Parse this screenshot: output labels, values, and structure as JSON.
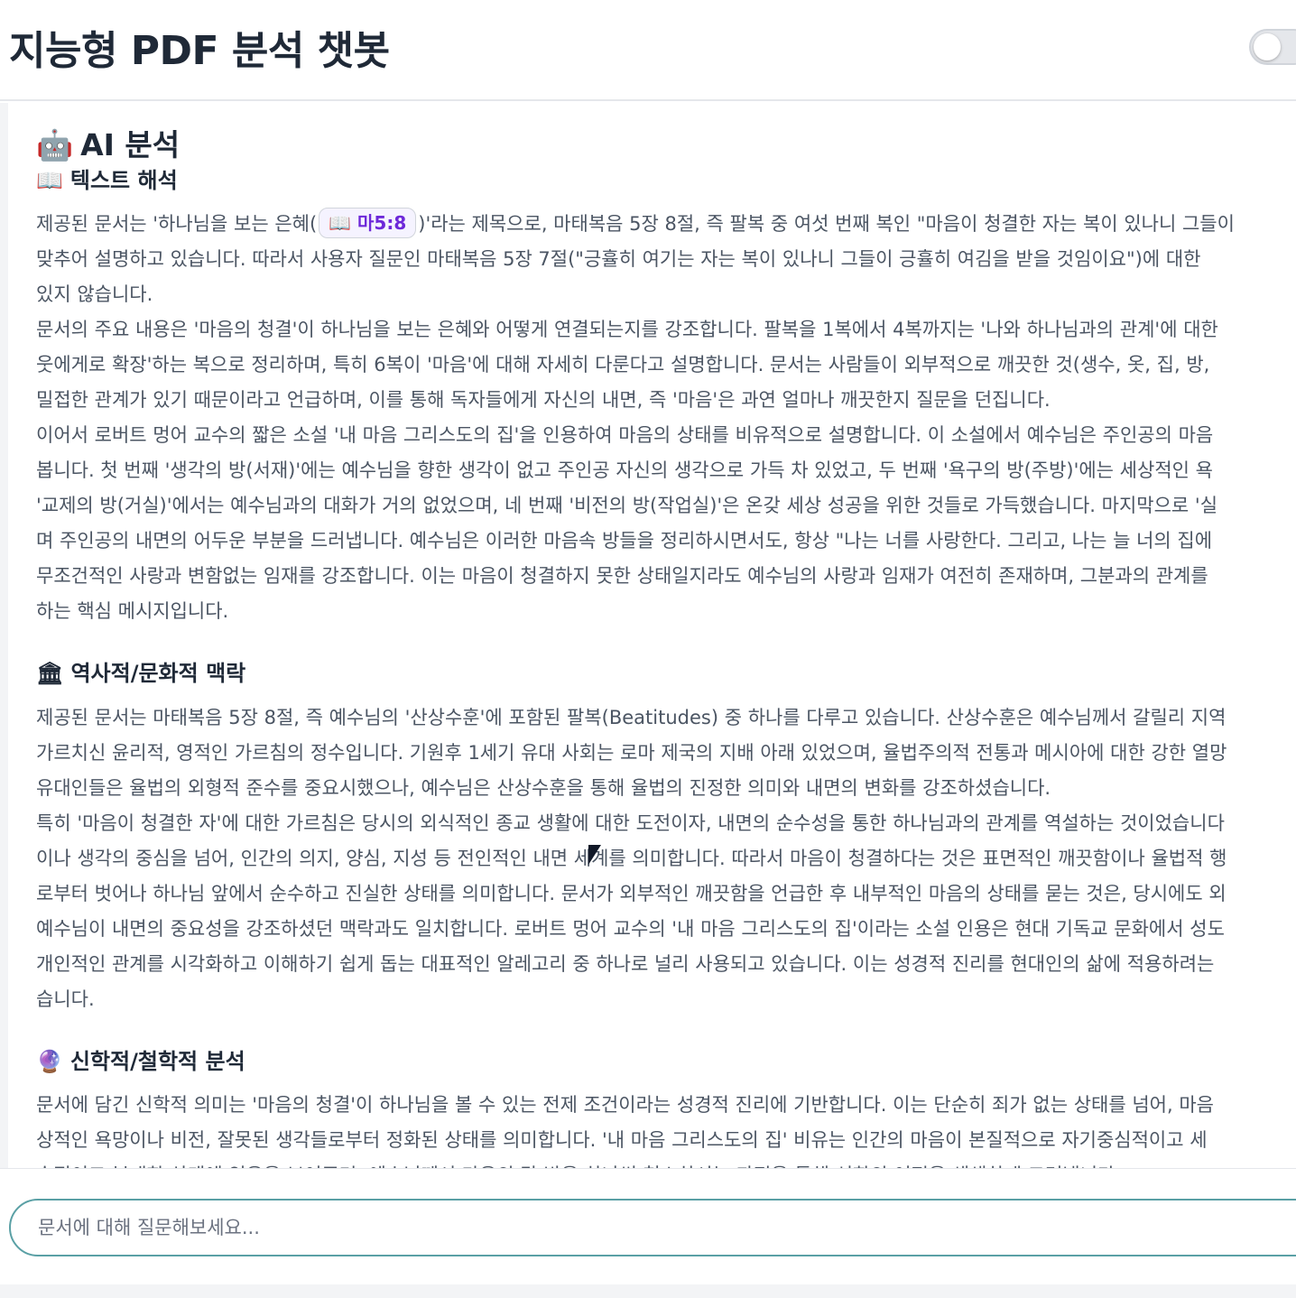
{
  "header": {
    "title": "지능형 PDF 분석 챗봇",
    "toggle_on": false
  },
  "panel": {
    "icon": "🤖",
    "title": "AI 분석"
  },
  "sections": [
    {
      "icon": "📖",
      "heading": "텍스트 해석",
      "lines": [
        {
          "before": "제공된 문서는 '하나님을 보는 은혜(",
          "chip_icon": "📖",
          "chip": "마5:8",
          "after": ")'라는 제목으로, 마태복음 5장 8절, 즉 팔복 중 여섯 번째 복인 \"마음이 청결한 자는 복이 있나니 그들이"
        },
        {
          "text": "맞추어 설명하고 있습니다. 따라서 사용자 질문인 마태복음 5장 7절(\"긍휼히 여기는 자는 복이 있나니 그들이 긍휼히 여김을 받을 것임이요\")에 대한"
        },
        {
          "text": "있지 않습니다."
        },
        {
          "text": "문서의 주요 내용은 '마음의 청결'이 하나님을 보는 은혜와 어떻게 연결되는지를 강조합니다. 팔복을 1복에서 4복까지는 '나와 하나님과의 관계'에 대한"
        },
        {
          "text": "웃에게로 확장'하는 복으로 정리하며, 특히 6복이 '마음'에 대해 자세히 다룬다고 설명합니다. 문서는 사람들이 외부적으로 깨끗한 것(생수, 옷, 집, 방,"
        },
        {
          "text": "밀접한 관계가 있기 때문이라고 언급하며, 이를 통해 독자들에게 자신의 내면, 즉 '마음'은 과연 얼마나 깨끗한지 질문을 던집니다."
        },
        {
          "text": "이어서 로버트 멍어 교수의 짧은 소설 '내 마음 그리스도의 집'을 인용하여 마음의 상태를 비유적으로 설명합니다. 이 소설에서 예수님은 주인공의 마음"
        },
        {
          "text": "봅니다. 첫 번째 '생각의 방(서재)'에는 예수님을 향한 생각이 없고 주인공 자신의 생각으로 가득 차 있었고, 두 번째 '욕구의 방(주방)'에는 세상적인 욕"
        },
        {
          "text": "'교제의 방(거실)'에서는 예수님과의 대화가 거의 없었으며, 네 번째 '비전의 방(작업실)'은 온갖 세상 성공을 위한 것들로 가득했습니다. 마지막으로 '실"
        },
        {
          "text": "며 주인공의 내면의 어두운 부분을 드러냅니다. 예수님은 이러한 마음속 방들을 정리하시면서도, 항상 \"나는 너를 사랑한다. 그리고, 나는 늘 너의 집에"
        },
        {
          "text": "무조건적인 사랑과 변함없는 임재를 강조합니다. 이는 마음이 청결하지 못한 상태일지라도 예수님의 사랑과 임재가 여전히 존재하며, 그분과의 관계를"
        },
        {
          "text": "하는 핵심 메시지입니다."
        }
      ]
    },
    {
      "icon": "🏛",
      "heading": "역사적/문화적 맥락",
      "lines": [
        {
          "text": "제공된 문서는 마태복음 5장 8절, 즉 예수님의 '산상수훈'에 포함된 팔복(Beatitudes) 중 하나를 다루고 있습니다. 산상수훈은 예수님께서 갈릴리 지역"
        },
        {
          "text": "가르치신 윤리적, 영적인 가르침의 정수입니다. 기원후 1세기 유대 사회는 로마 제국의 지배 아래 있었으며, 율법주의적 전통과 메시아에 대한 강한 열망"
        },
        {
          "text": "유대인들은 율법의 외형적 준수를 중요시했으나, 예수님은 산상수훈을 통해 율법의 진정한 의미와 내면의 변화를 강조하셨습니다."
        },
        {
          "text": "특히 '마음이 청결한 자'에 대한 가르침은 당시의 외식적인 종교 생활에 대한 도전이자, 내면의 순수성을 통한 하나님과의 관계를 역설하는 것이었습니다"
        },
        {
          "text": "이나 생각의 중심을 넘어, 인간의 의지, 양심, 지성 등 전인적인 내면 세계를 의미합니다. 따라서 마음이 청결하다는 것은 표면적인 깨끗함이나 율법적 행"
        },
        {
          "text": "로부터 벗어나 하나님 앞에서 순수하고 진실한 상태를 의미합니다. 문서가 외부적인 깨끗함을 언급한 후 내부적인 마음의 상태를 묻는 것은, 당시에도 외"
        },
        {
          "text": "예수님이 내면의 중요성을 강조하셨던 맥락과도 일치합니다. 로버트 멍어 교수의 '내 마음 그리스도의 집'이라는 소설 인용은 현대 기독교 문화에서 성도"
        },
        {
          "text": "개인적인 관계를 시각화하고 이해하기 쉽게 돕는 대표적인 알레고리 중 하나로 널리 사용되고 있습니다. 이는 성경적 진리를 현대인의 삶에 적용하려는"
        },
        {
          "text": "습니다."
        }
      ]
    },
    {
      "icon": "🔮",
      "heading": "신학적/철학적 분석",
      "lines": [
        {
          "text": "문서에 담긴 신학적 의미는 '마음의 청결'이 하나님을 볼 수 있는 전제 조건이라는 성경적 진리에 기반합니다. 이는 단순히 죄가 없는 상태를 넘어, 마음"
        },
        {
          "text": "상적인 욕망이나 비전, 잘못된 생각들로부터 정화된 상태를 의미합니다. '내 마음 그리스도의 집' 비유는 인간의 마음이 본질적으로 자기중심적이고 세"
        },
        {
          "text": "속적이고 부패한 상태에 있음을 보여주며, 예수님께서 마음의 각 방을 하나씩 청소하시는 과정을 통해 성화의 여정을 생생하게 그려냅니다."
        }
      ]
    }
  ],
  "chat": {
    "placeholder": "문서에 대해 질문해보세요...",
    "value": ""
  }
}
